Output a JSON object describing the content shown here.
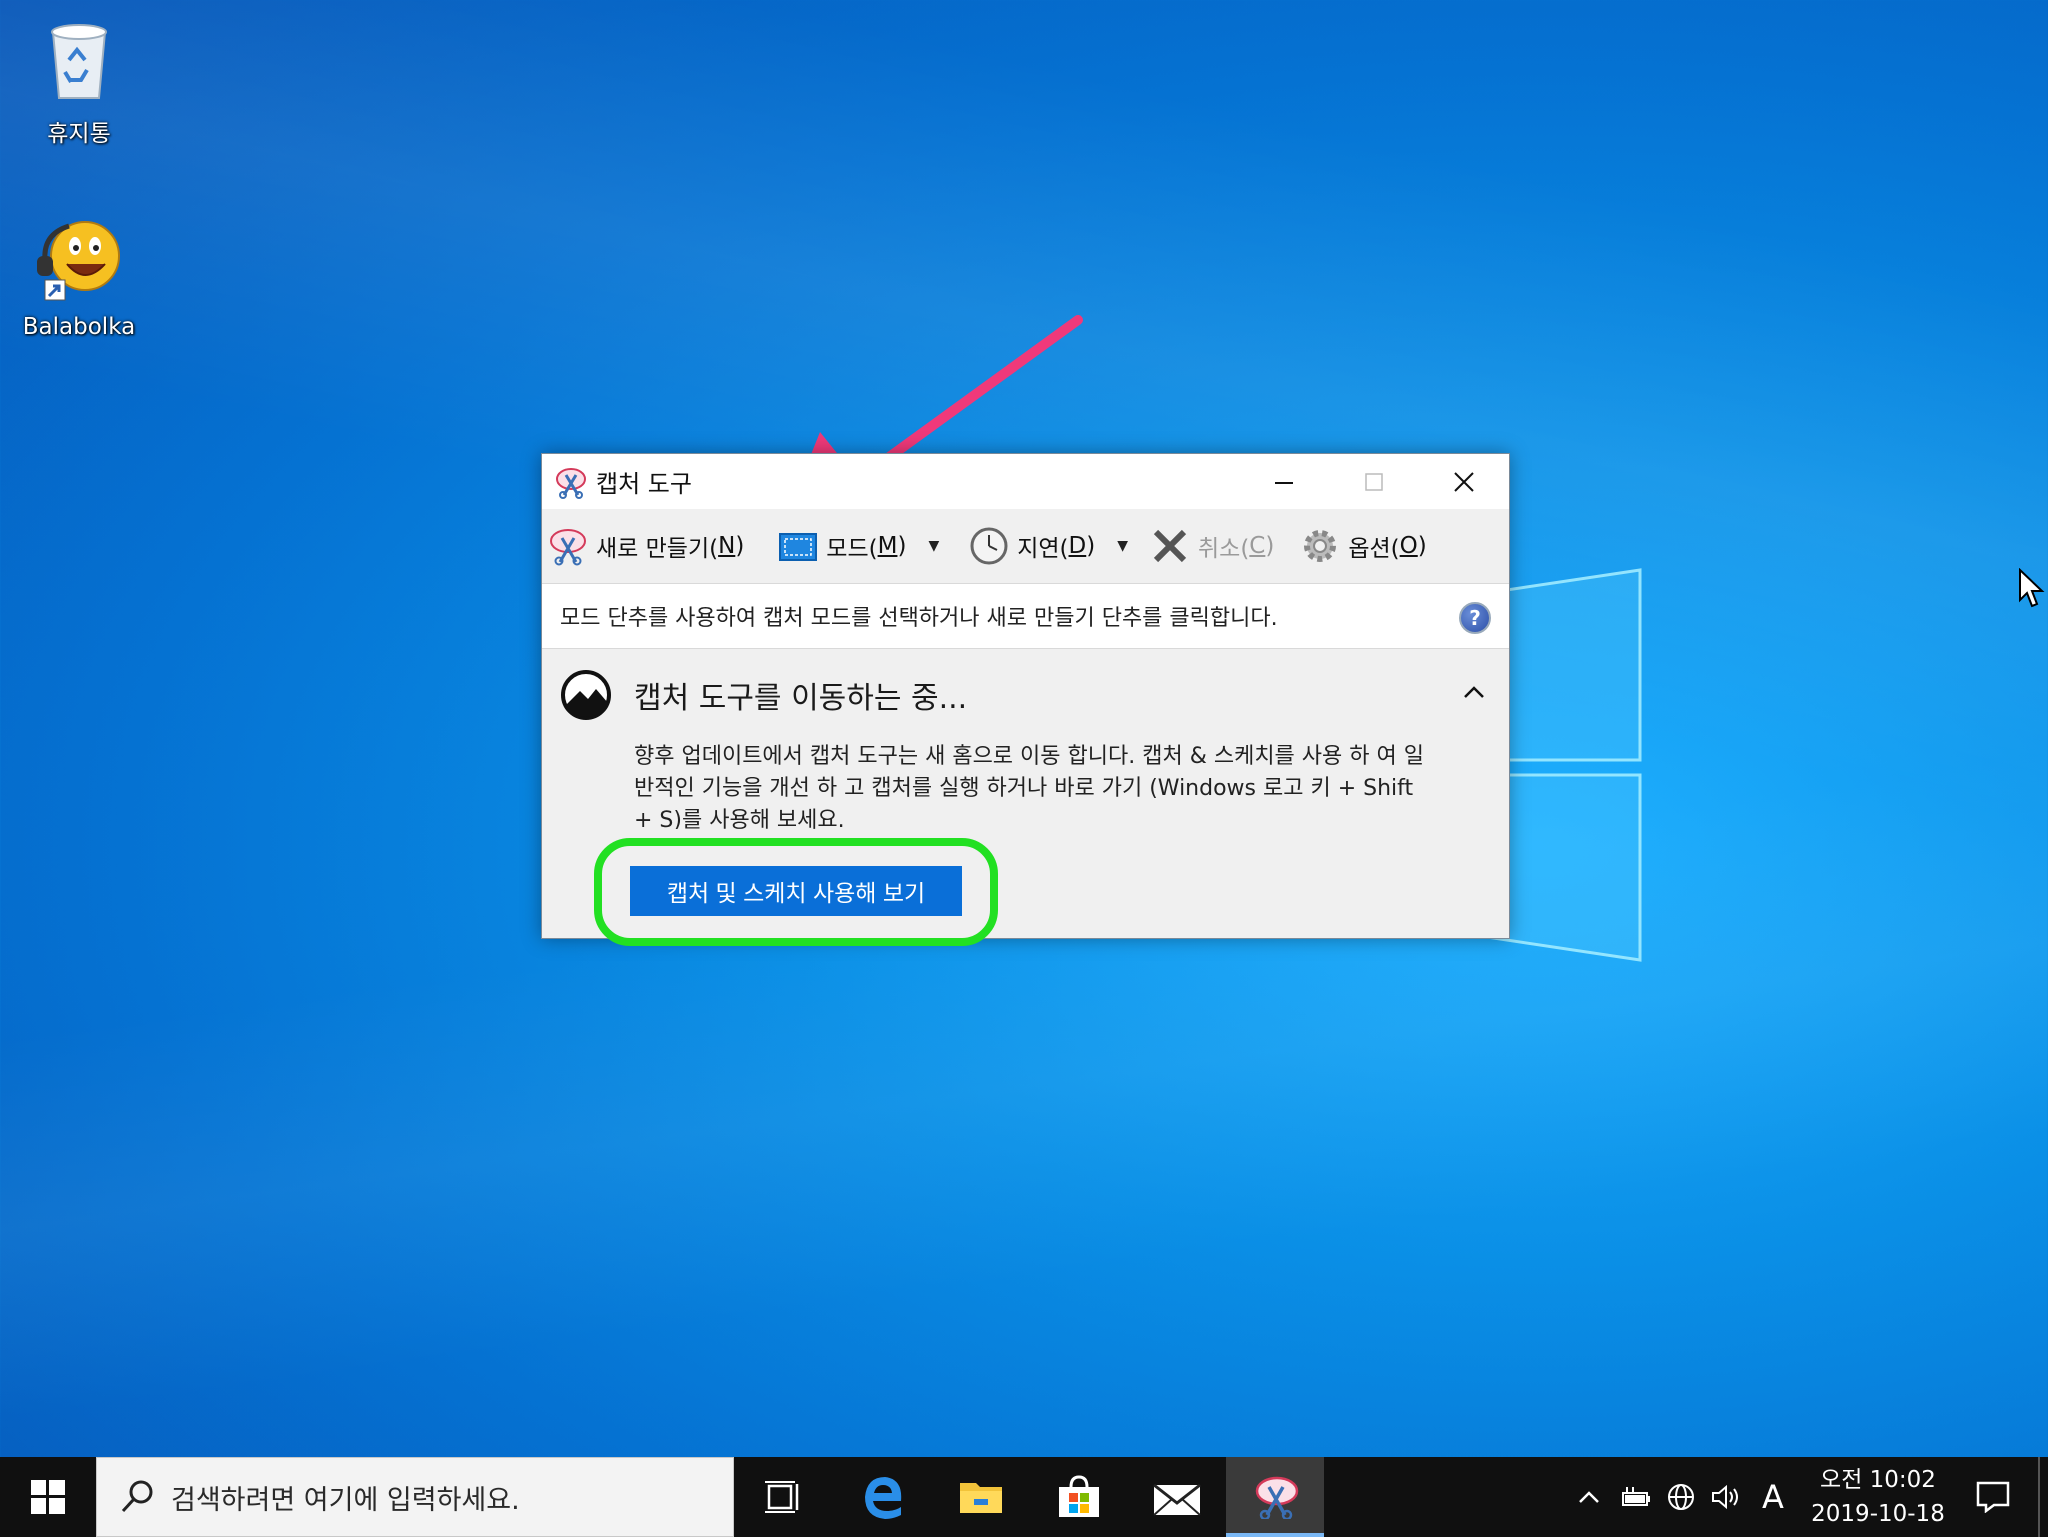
{
  "desktop": {
    "icons": [
      {
        "label": "휴지통",
        "icon": "recycle-bin-icon"
      },
      {
        "label": "Balabolka",
        "icon": "balabolka-icon"
      }
    ]
  },
  "window": {
    "title": "캡처 도구",
    "toolbar": {
      "new_label": "새로 만들기(",
      "new_key": "N",
      "new_end": ")",
      "mode_label": "모드(",
      "mode_key": "M",
      "mode_end": ")",
      "delay_label": "지연(",
      "delay_key": "D",
      "delay_end": ")",
      "cancel_label": "취소(",
      "cancel_key": "C",
      "cancel_end": ")",
      "options_label": "옵션(",
      "options_key": "O",
      "options_end": ")"
    },
    "hint": "모드 단추를 사용하여 캡처 모드를 선택하거나 새로 만들기 단추를 클릭합니다.",
    "help_glyph": "?",
    "notice": {
      "title": "캡처 도구를 이동하는 중...",
      "body": "향후 업데이트에서 캡처 도구는 새 홈으로 이동 합니다. 캡처 & 스케치를 사용 하 여 일반적인 기능을 개선 하 고 캡처를 실행 하거나 바로 가기 (Windows 로고 키 + Shift + S)를 사용해 보세요.",
      "button": "캡처 및 스케치 사용해 보기"
    }
  },
  "taskbar": {
    "search_placeholder": "검색하려면 여기에 입력하세요.",
    "tray_lang": "A",
    "clock_time": "오전 10:02",
    "clock_date": "2019-10-18"
  },
  "colors": {
    "accent": "#0a6fd8",
    "highlight_ring": "#22e022",
    "arrow": "#f0397a"
  }
}
